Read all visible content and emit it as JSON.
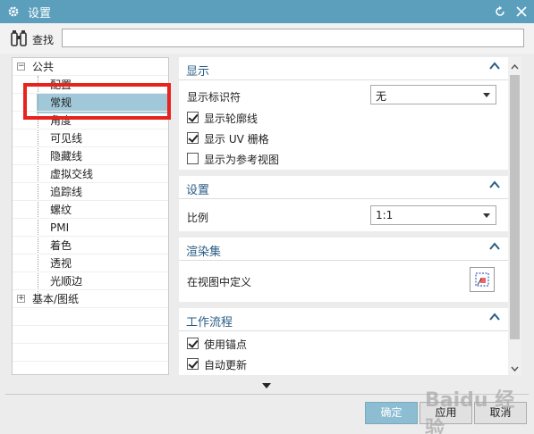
{
  "window": {
    "title": "设置"
  },
  "search": {
    "label": "查找",
    "value": ""
  },
  "tree": {
    "items": [
      {
        "label": "公共"
      },
      {
        "label": "配置"
      },
      {
        "label": "常规"
      },
      {
        "label": "角度"
      },
      {
        "label": "可见线"
      },
      {
        "label": "隐藏线"
      },
      {
        "label": "虚拟交线"
      },
      {
        "label": "追踪线"
      },
      {
        "label": "螺纹"
      },
      {
        "label": "PMI"
      },
      {
        "label": "着色"
      },
      {
        "label": "透视"
      },
      {
        "label": "光顺边"
      },
      {
        "label": "基本/图纸"
      }
    ],
    "selected": "常规"
  },
  "panel": {
    "display": {
      "header": "显示",
      "identifier_label": "显示标识符",
      "identifier_value": "无",
      "checkboxes": [
        {
          "label": "显示轮廓线",
          "checked": true
        },
        {
          "label": "显示 UV 栅格",
          "checked": true
        },
        {
          "label": "显示为参考视图",
          "checked": false
        }
      ]
    },
    "settings": {
      "header": "设置",
      "scale_label": "比例",
      "scale_value": "1:1"
    },
    "render_set": {
      "header": "渲染集",
      "define_label": "在视图中定义"
    },
    "workflow": {
      "header": "工作流程",
      "checkboxes": [
        {
          "label": "使用锚点",
          "checked": true
        },
        {
          "label": "自动更新",
          "checked": true
        }
      ]
    }
  },
  "buttons": {
    "ok": "确定",
    "apply": "应用",
    "cancel": "取消"
  },
  "watermark": "Baidu 经验",
  "colors": {
    "titlebar": "#5b9fbd",
    "selection": "#a1c8d8",
    "header_text": "#2a5d86",
    "highlight": "#e8231e"
  }
}
